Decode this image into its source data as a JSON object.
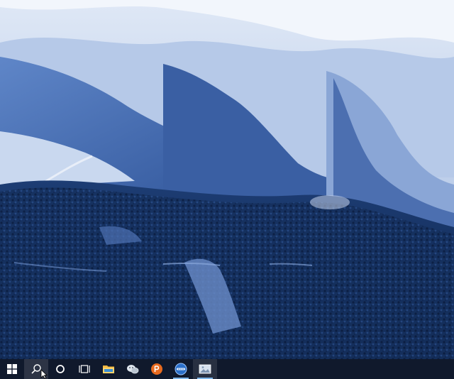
{
  "wallpaper": {
    "description_icon": "snowy-mountain-wallpaper",
    "colors": {
      "sky_snow": "#e9f0fa",
      "snow_mid": "#9cb4dc",
      "snow_shadow": "#4a6fb3",
      "rock": "#2f4f8a",
      "forest": "#173566",
      "forest_dark": "#0c2146"
    }
  },
  "taskbar": {
    "items": [
      {
        "id": "start",
        "icon": "windows-logo-icon"
      },
      {
        "id": "search",
        "icon": "search-icon",
        "state": "hover"
      },
      {
        "id": "cortana",
        "icon": "cortana-circle-icon"
      },
      {
        "id": "task-view",
        "icon": "task-view-icon"
      },
      {
        "id": "file-explorer",
        "icon": "folder-icon"
      },
      {
        "id": "wechat",
        "icon": "wechat-icon"
      },
      {
        "id": "powerpoint-like",
        "icon": "orange-p-app-icon"
      },
      {
        "id": "blue-app",
        "icon": "blue-round-app-icon",
        "state": "open"
      },
      {
        "id": "image-app",
        "icon": "image-viewer-icon",
        "state": "active"
      }
    ],
    "colors": {
      "background": "#101828",
      "accent": "#7fb6e8",
      "folder": "#f4b942",
      "wechat": "#dfe6ee",
      "orange": "#e86a1e"
    }
  }
}
